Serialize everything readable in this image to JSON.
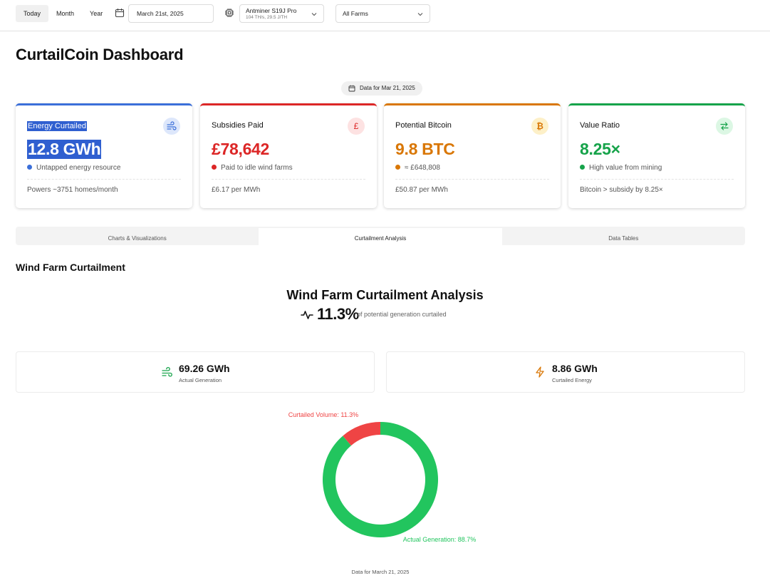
{
  "toolbar": {
    "periods": [
      "Today",
      "Month",
      "Year"
    ],
    "active_period": "Today",
    "date_value": "March 21st, 2025",
    "miner": {
      "name": "Antminer S19J Pro",
      "spec": "104 TH/s, 29.5 J/TH"
    },
    "farm_filter": "All Farms"
  },
  "page": {
    "title": "CurtailCoin Dashboard",
    "data_date": "Data for Mar 21, 2025"
  },
  "cards": [
    {
      "label": "Energy Curtailed",
      "value": "12.8 GWh",
      "note": "Untapped energy resource",
      "footer": "Powers ~3751 homes/month",
      "accent": "#3b6fd9",
      "icon": "wind-icon"
    },
    {
      "label": "Subsidies Paid",
      "value": "£78,642",
      "note": "Paid to idle wind farms",
      "footer": "£6.17 per MWh",
      "accent": "#dc2626",
      "icon": "pound-icon"
    },
    {
      "label": "Potential Bitcoin",
      "value": "9.8 BTC",
      "note": "≈ £648,808",
      "footer": "£50.87 per MWh",
      "accent": "#d97706",
      "icon": "bitcoin-icon"
    },
    {
      "label": "Value Ratio",
      "value": "8.25×",
      "note": "High value from mining",
      "footer": "Bitcoin > subsidy by 8.25×",
      "accent": "#16a34a",
      "icon": "arrows-exchange-icon"
    }
  ],
  "tabs": [
    "Charts & Visualizations",
    "Curtailment Analysis",
    "Data Tables"
  ],
  "active_tab": "Curtailment Analysis",
  "section": {
    "title": "Wind Farm Curtailment",
    "analysis_title": "Wind Farm Curtailment Analysis",
    "percent": "11.3%",
    "percent_text": "of potential generation curtailed"
  },
  "metrics": [
    {
      "value": "69.26 GWh",
      "label": "Actual Generation",
      "icon": "wind-icon",
      "color": "#16a34a"
    },
    {
      "value": "8.86 GWh",
      "label": "Curtailed Energy",
      "icon": "lightning-icon",
      "color": "#d97706"
    }
  ],
  "chart_data": {
    "type": "pie",
    "donut": true,
    "slices": [
      {
        "name": "Curtailed Volume",
        "value": 11.3,
        "label": "Curtailed Volume: 11.3%",
        "color": "#ef4444"
      },
      {
        "name": "Actual Generation",
        "value": 88.7,
        "label": "Actual Generation: 88.7%",
        "color": "#22c55e"
      }
    ],
    "caption": "Data for March 21, 2025"
  }
}
